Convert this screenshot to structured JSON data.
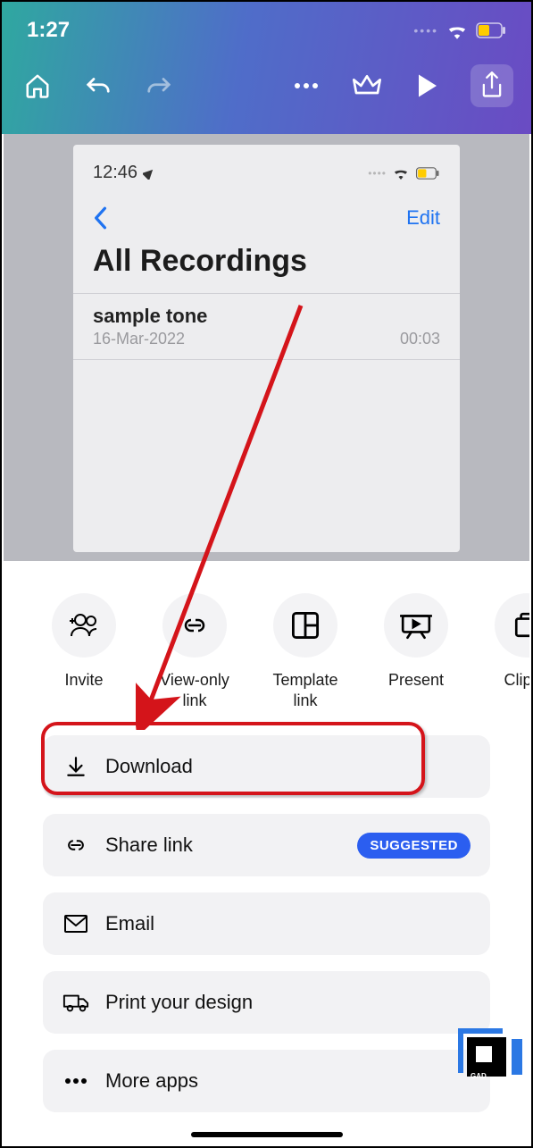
{
  "status": {
    "time": "1:27"
  },
  "canvas": {
    "status_time": "12:46",
    "edit_label": "Edit",
    "title": "All Recordings",
    "item": {
      "name": "sample tone",
      "date": "16-Mar-2022",
      "duration": "00:03"
    }
  },
  "share_row": [
    {
      "label": "Invite"
    },
    {
      "label": "View-only link"
    },
    {
      "label": "Template link"
    },
    {
      "label": "Present"
    },
    {
      "label": "Clipbo"
    }
  ],
  "options": {
    "download": "Download",
    "share_link": "Share link",
    "suggested": "SUGGESTED",
    "email": "Email",
    "print": "Print your design",
    "more": "More apps"
  }
}
